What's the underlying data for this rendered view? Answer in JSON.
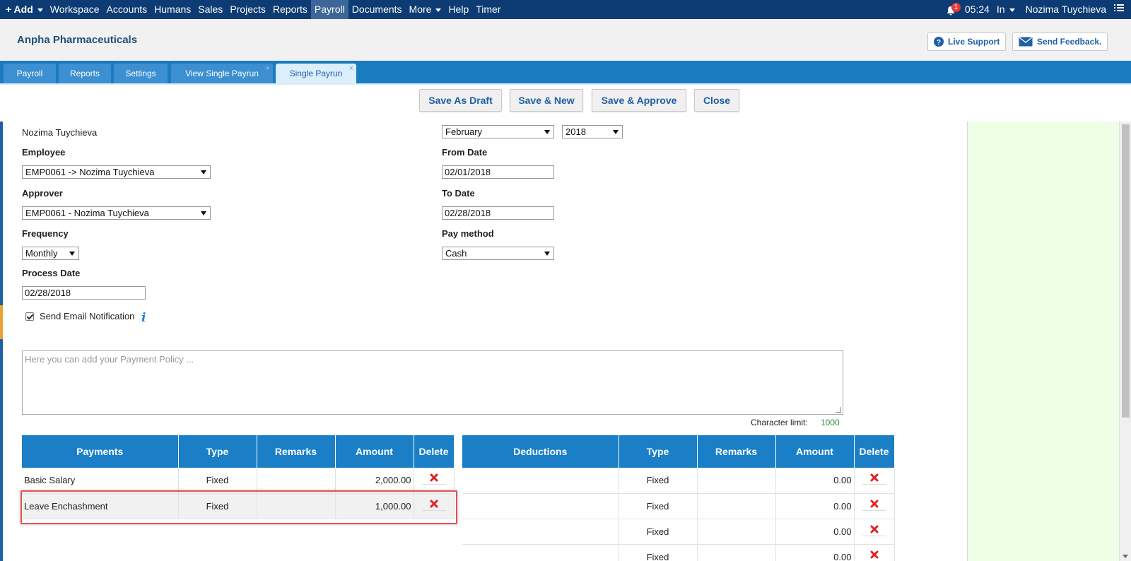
{
  "topnav": {
    "add_label": "+ Add",
    "items": [
      "Workspace",
      "Accounts",
      "Humans",
      "Sales",
      "Projects",
      "Reports",
      "Payroll",
      "Documents",
      "More",
      "Help",
      "Timer"
    ],
    "notification_count": "1",
    "time": "05:24",
    "status": "In",
    "user_name": "Nozima Tuychieva"
  },
  "header": {
    "company": "Anpha Pharmaceuticals",
    "live_support": "Live Support",
    "send_feedback": "Send Feedback."
  },
  "tabs": [
    {
      "label": "Payroll"
    },
    {
      "label": "Reports"
    },
    {
      "label": "Settings"
    },
    {
      "label": "View Single Payrun"
    },
    {
      "label": "Single Payrun"
    }
  ],
  "actions": {
    "save_draft": "Save As Draft",
    "save_new": "Save & New",
    "save_approve": "Save & Approve",
    "close": "Close"
  },
  "form": {
    "owner_name": "Nozima Tuychieva",
    "employee_label": "Employee",
    "employee_value": "EMP0061 -> Nozima Tuychieva",
    "approver_label": "Approver",
    "approver_value": "EMP0061 - Nozima Tuychieva",
    "frequency_label": "Frequency",
    "frequency_value": "Monthly",
    "process_date_label": "Process Date",
    "process_date_value": "02/28/2018",
    "send_email_label": "Send Email Notification",
    "month_value": "February",
    "year_value": "2018",
    "from_date_label": "From Date",
    "from_date_value": "02/01/2018",
    "to_date_label": "To Date",
    "to_date_value": "02/28/2018",
    "pay_method_label": "Pay method",
    "pay_method_value": "Cash",
    "policy_placeholder": "Here you can add your Payment Policy ...",
    "char_limit_label": "Character limit:",
    "char_limit_value": "1000"
  },
  "payments": {
    "headers": [
      "Payments",
      "Type",
      "Remarks",
      "Amount",
      "Delete"
    ],
    "rows": [
      {
        "name": "Basic Salary",
        "type": "Fixed",
        "remarks": "",
        "amount": "2,000.00"
      },
      {
        "name": "Leave Enchashment",
        "type": "Fixed",
        "remarks": "",
        "amount": "1,000.00"
      }
    ]
  },
  "deductions": {
    "headers": [
      "Deductions",
      "Type",
      "Remarks",
      "Amount",
      "Delete"
    ],
    "rows": [
      {
        "name": "",
        "type": "Fixed",
        "remarks": "",
        "amount": "0.00"
      },
      {
        "name": "",
        "type": "Fixed",
        "remarks": "",
        "amount": "0.00"
      },
      {
        "name": "",
        "type": "Fixed",
        "remarks": "",
        "amount": "0.00"
      },
      {
        "name": "",
        "type": "Fixed",
        "remarks": "",
        "amount": "0.00"
      }
    ]
  }
}
